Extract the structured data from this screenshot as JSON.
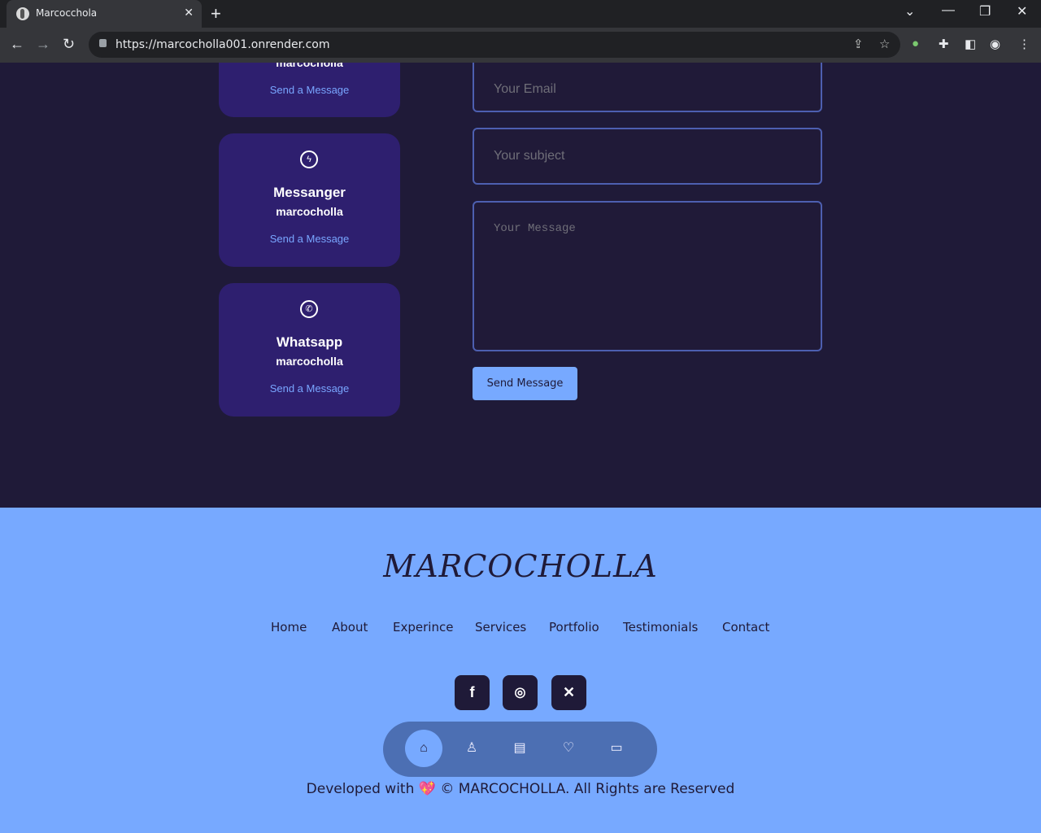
{
  "browser": {
    "tab_title": "Marcocchola",
    "url": "https://marcocholla001.onrender.com"
  },
  "contact_cards": [
    {
      "title": "",
      "user": "marcocholla",
      "link": "Send a Message",
      "icon": "email-icon"
    },
    {
      "title": "Messanger",
      "user": "marcocholla",
      "link": "Send a Message",
      "icon": "messenger-icon"
    },
    {
      "title": "Whatsapp",
      "user": "marcocholla",
      "link": "Send a Message",
      "icon": "whatsapp-icon"
    }
  ],
  "form": {
    "email_placeholder": "Your Email",
    "subject_placeholder": "Your subject",
    "message_placeholder": "Your Message",
    "send_label": "Send Message"
  },
  "footer": {
    "logo": "MARCOCHOLLA",
    "nav": [
      "Home",
      "About",
      "Experince",
      "Services",
      "Portfolio",
      "Testimonials",
      "Contact"
    ],
    "socials": [
      "facebook-icon",
      "instagram-icon",
      "x-icon"
    ],
    "bottom_nav": [
      "home-icon",
      "user-icon",
      "book-icon",
      "heart-handshake-icon",
      "message-icon"
    ],
    "credit": "Developed with 💖 © MARCOCHOLLA. All Rights are Reserved"
  },
  "colors": {
    "background": "#1f1a38",
    "card": "#2e1f6f",
    "accent": "#77a9ff"
  }
}
